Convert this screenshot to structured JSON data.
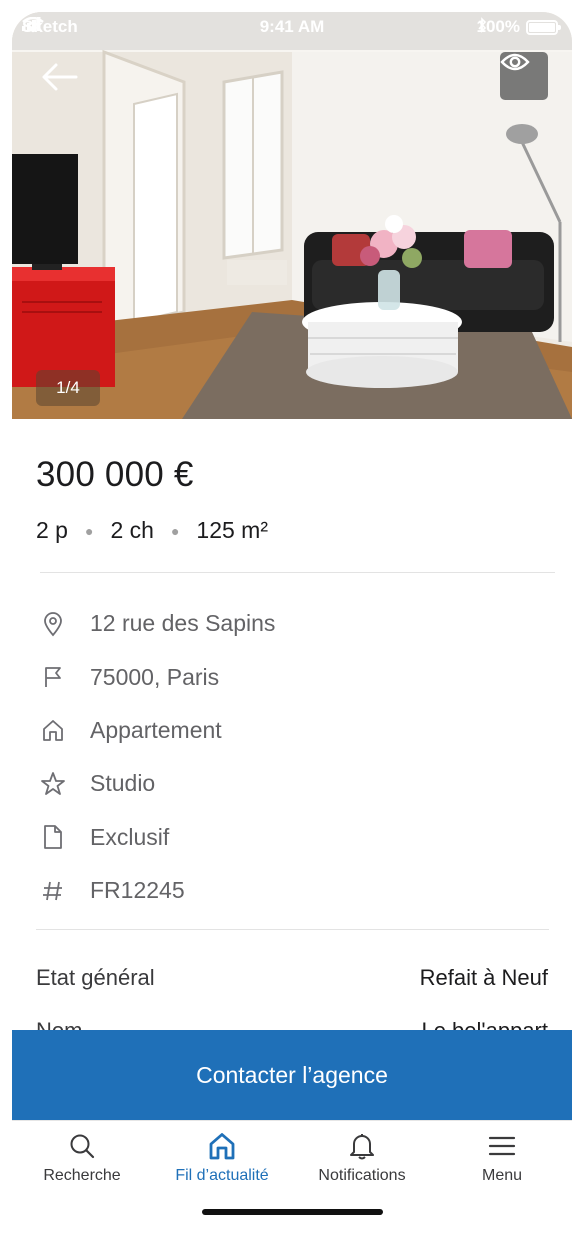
{
  "status_bar": {
    "carrier": "Sketch",
    "time": "9:41 AM",
    "battery": "100%"
  },
  "photo": {
    "counter": "1/4"
  },
  "listing": {
    "price": "300 000 €",
    "specs": [
      "2 p",
      "2 ch",
      "125 m²"
    ],
    "info": [
      {
        "icon": "map-pin-icon",
        "text": "12 rue des Sapins"
      },
      {
        "icon": "flag-icon",
        "text": "75000, Paris"
      },
      {
        "icon": "home-icon",
        "text": "Appartement"
      },
      {
        "icon": "star-icon",
        "text": "Studio"
      },
      {
        "icon": "document-icon",
        "text": "Exclusif"
      },
      {
        "icon": "hash-icon",
        "text": "FR12245"
      }
    ],
    "details": [
      {
        "label": "Etat général",
        "value": "Refait à Neuf"
      },
      {
        "label": "Nom",
        "value": "Le bel'appart"
      }
    ]
  },
  "cta": {
    "label": "Contacter l’agence"
  },
  "tabbar": {
    "tabs": [
      {
        "label": "Recherche",
        "icon": "search-icon"
      },
      {
        "label": "Fil d’actualité",
        "icon": "home-icon"
      },
      {
        "label": "Notifications",
        "icon": "bell-icon"
      },
      {
        "label": "Menu",
        "icon": "menu-icon"
      }
    ],
    "active_index": 1
  },
  "colors": {
    "accent": "#1f70b8",
    "text_primary": "#1c1c1e",
    "text_secondary": "#636366"
  }
}
